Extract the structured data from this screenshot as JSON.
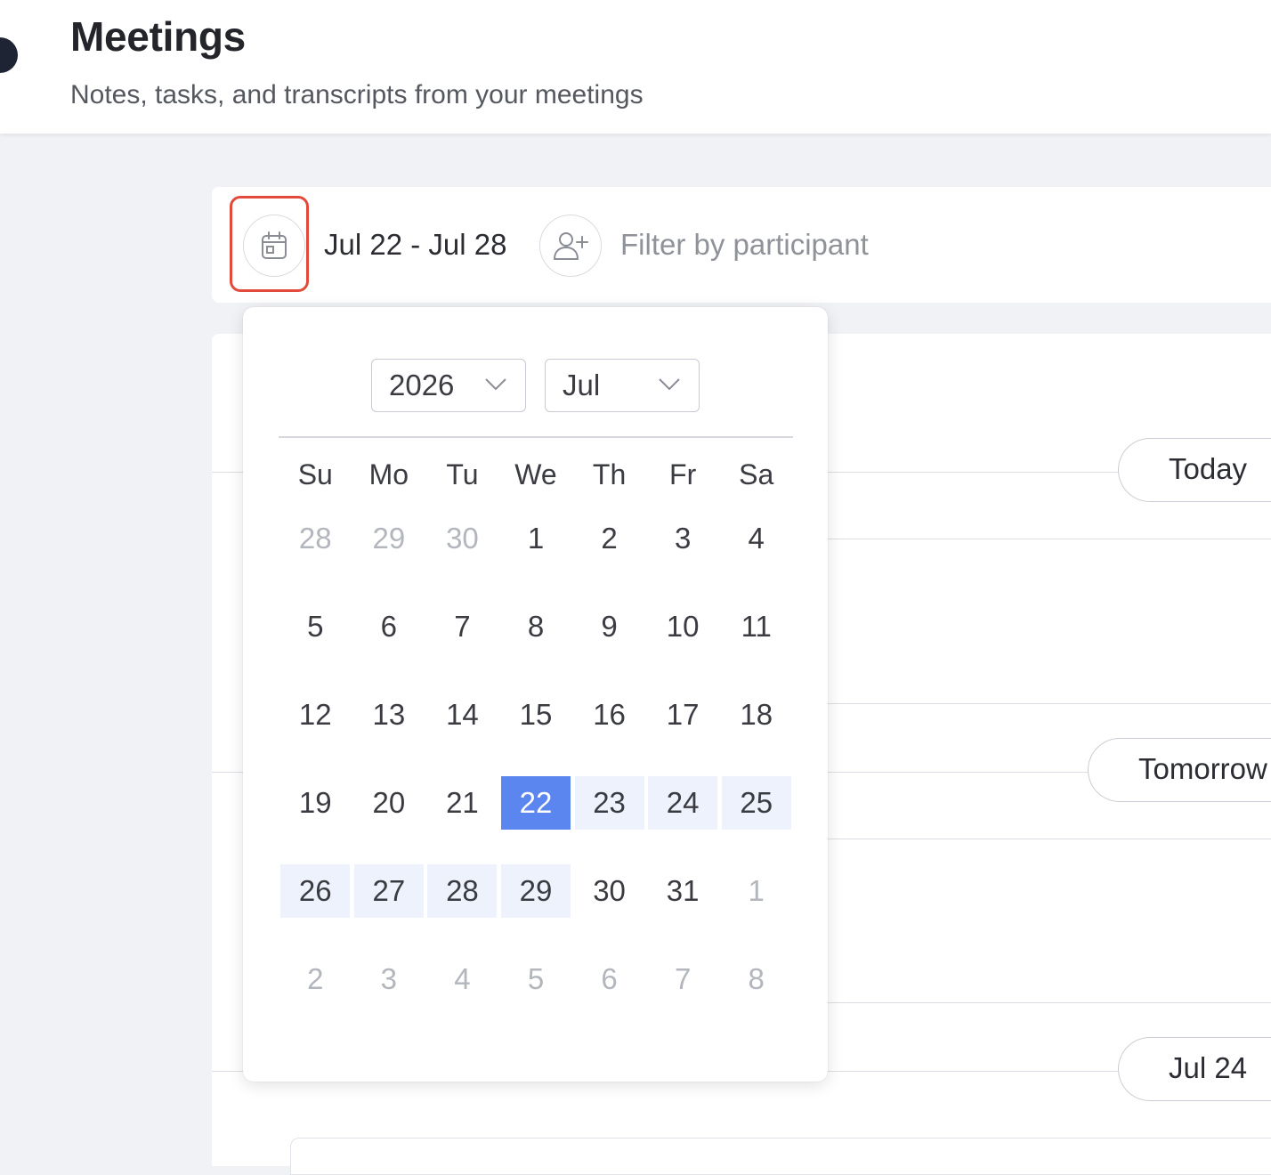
{
  "header": {
    "title": "Meetings",
    "subtitle": "Notes, tasks, and transcripts from your meetings"
  },
  "toolbar": {
    "date_range": "Jul 22 - Jul 28",
    "filter_placeholder": "Filter by participant",
    "calendar_icon": "calendar-icon",
    "participant_icon": "add-person-icon"
  },
  "datepicker": {
    "year": "2026",
    "month": "Jul",
    "weekdays": [
      "Su",
      "Mo",
      "Tu",
      "We",
      "Th",
      "Fr",
      "Sa"
    ],
    "weeks": [
      [
        {
          "d": "28",
          "muted": true
        },
        {
          "d": "29",
          "muted": true
        },
        {
          "d": "30",
          "muted": true
        },
        {
          "d": "1"
        },
        {
          "d": "2"
        },
        {
          "d": "3"
        },
        {
          "d": "4"
        }
      ],
      [
        {
          "d": "5"
        },
        {
          "d": "6"
        },
        {
          "d": "7"
        },
        {
          "d": "8"
        },
        {
          "d": "9"
        },
        {
          "d": "10"
        },
        {
          "d": "11"
        }
      ],
      [
        {
          "d": "12"
        },
        {
          "d": "13"
        },
        {
          "d": "14"
        },
        {
          "d": "15"
        },
        {
          "d": "16"
        },
        {
          "d": "17"
        },
        {
          "d": "18"
        }
      ],
      [
        {
          "d": "19"
        },
        {
          "d": "20"
        },
        {
          "d": "21"
        },
        {
          "d": "22",
          "selected": true
        },
        {
          "d": "23",
          "range": true
        },
        {
          "d": "24",
          "range": true
        },
        {
          "d": "25",
          "range": true
        }
      ],
      [
        {
          "d": "26",
          "range": true
        },
        {
          "d": "27",
          "range": true
        },
        {
          "d": "28",
          "range": true
        },
        {
          "d": "29",
          "range": true
        },
        {
          "d": "30"
        },
        {
          "d": "31"
        },
        {
          "d": "1",
          "muted": true
        }
      ],
      [
        {
          "d": "2",
          "muted": true
        },
        {
          "d": "3",
          "muted": true
        },
        {
          "d": "4",
          "muted": true
        },
        {
          "d": "5",
          "muted": true
        },
        {
          "d": "6",
          "muted": true
        },
        {
          "d": "7",
          "muted": true
        },
        {
          "d": "8",
          "muted": true
        }
      ]
    ]
  },
  "timeline": {
    "labels": [
      "Today",
      "Tomorrow",
      "Jul 24"
    ]
  },
  "colors": {
    "selected": "#5b86ef",
    "range": "#eef2fd",
    "focus_ring": "#e24a3b"
  }
}
